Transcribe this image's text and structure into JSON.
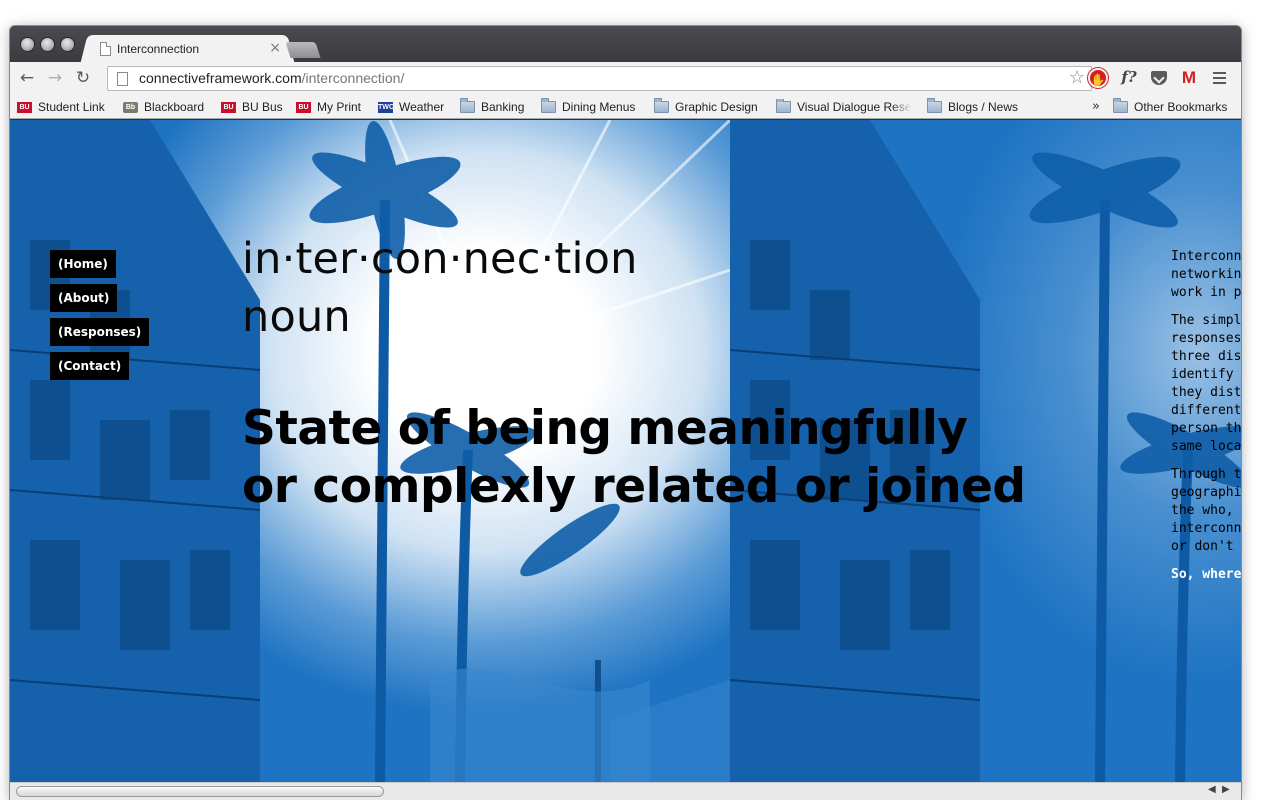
{
  "browser": {
    "tab_title": "Interconnection",
    "tab_close": "×",
    "url_host": "connectiveframework.com",
    "url_path": "/interconnection/",
    "back_glyph": "←",
    "forward_glyph": "→",
    "reload_glyph": "↻",
    "star_glyph": "☆",
    "ext_f_label": "f?",
    "ext_gmail_label": "M",
    "more_glyph": "»"
  },
  "bookmarks": [
    {
      "label": "Student Link",
      "icon": "BU",
      "kind": "bu"
    },
    {
      "label": "Blackboard",
      "icon": "Bb",
      "kind": "bb"
    },
    {
      "label": "BU Bus",
      "icon": "BU",
      "kind": "bu"
    },
    {
      "label": "My Print",
      "icon": "BU",
      "kind": "bu"
    },
    {
      "label": "Weather",
      "icon": "TWC",
      "kind": "twc"
    },
    {
      "label": "Banking",
      "icon": "folder",
      "kind": "folder"
    },
    {
      "label": "Dining Menus",
      "icon": "folder",
      "kind": "folder"
    },
    {
      "label": "Graphic Design",
      "icon": "folder",
      "kind": "folder"
    },
    {
      "label": "Visual Dialogue Rese",
      "icon": "folder",
      "kind": "folder"
    },
    {
      "label": "Blogs / News",
      "icon": "folder",
      "kind": "folder"
    }
  ],
  "other_bookmarks": "Other Bookmarks",
  "page": {
    "nav": [
      "(Home)",
      "(About)",
      "(Responses)",
      "(Contact)"
    ],
    "word_line1": "in·ter·con·nec·tion",
    "word_line2": "noun",
    "definition_line1": "State of being meaningfully",
    "definition_line2": "or complexly related or joined",
    "side_p1": "Interconn\nnetworkin\nwork in p",
    "side_p2": "The simpl\nresponses\nthree dis\nidentify\nthey dist\ndifferent\nperson th\nsame loca",
    "side_p3": "Through t\ngeographi\nthe who,\ninterconn\nor don't",
    "side_p4": "So, where"
  },
  "colors": {
    "photo_blue": "#1e73c2",
    "nav_bg": "#000000"
  }
}
